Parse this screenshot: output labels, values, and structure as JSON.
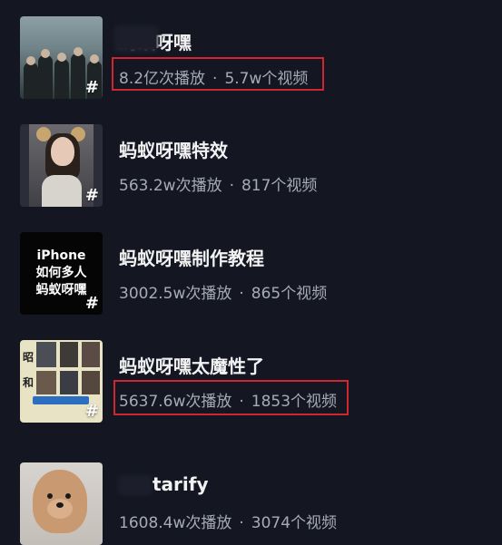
{
  "items": [
    {
      "title": "蚂蚁呀嘿",
      "plays": "8.2亿次播放",
      "separator": "·",
      "videos": "5.7w个视频",
      "hash": "#",
      "highlighted": true
    },
    {
      "title": "蚂蚁呀嘿特效",
      "plays": "563.2w次播放",
      "separator": "·",
      "videos": "817个视频",
      "hash": "#",
      "highlighted": false
    },
    {
      "title": "蚂蚁呀嘿制作教程",
      "plays": "3002.5w次播放",
      "separator": "·",
      "videos": "865个视频",
      "hash": "#",
      "highlighted": false,
      "thumb_text": [
        "iPhone",
        "如何多人",
        "蚂蚁呀嘿"
      ]
    },
    {
      "title": "蚂蚁呀嘿太魔性了",
      "plays": "5637.6w次播放",
      "separator": "·",
      "videos": "1853个视频",
      "hash": "#",
      "highlighted": true,
      "thumb_chars": [
        "昭",
        "和"
      ]
    },
    {
      "title": "tarify",
      "plays": "1608.4w次播放",
      "separator": "·",
      "videos": "3074个视频",
      "hash": "#",
      "highlighted": false
    }
  ],
  "colors": {
    "background": "#141722",
    "highlight_box": "#d0262f",
    "meta_text": "#a7abb6"
  }
}
